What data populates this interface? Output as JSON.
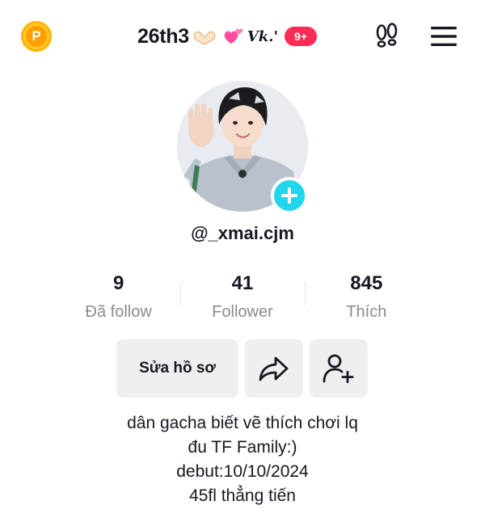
{
  "header": {
    "coin_label": "P",
    "title": "26th3",
    "title_script": "Vk.'",
    "notification_badge": "9+",
    "footprint_icon": "footprints-icon",
    "menu_icon": "hamburger-menu-icon"
  },
  "profile": {
    "username": "@_xmai.cjm",
    "add_icon": "plus-icon"
  },
  "stats": [
    {
      "value": "9",
      "label": "Đã follow"
    },
    {
      "value": "41",
      "label": "Follower"
    },
    {
      "value": "845",
      "label": "Thích"
    }
  ],
  "actions": {
    "edit_label": "Sửa hồ sơ",
    "share_icon": "share-arrow-icon",
    "add_friend_icon": "add-friend-icon"
  },
  "bio": [
    "dân gacha biết vẽ thích chơi lq",
    "đu TF Family:)",
    "debut:10/10/2024",
    "45fl thẳng tiến"
  ],
  "colors": {
    "accent": "#fe2c55",
    "plus_button": "#20d5ec",
    "coin": "#ffc72c",
    "secondary_text": "#8a8b91"
  }
}
